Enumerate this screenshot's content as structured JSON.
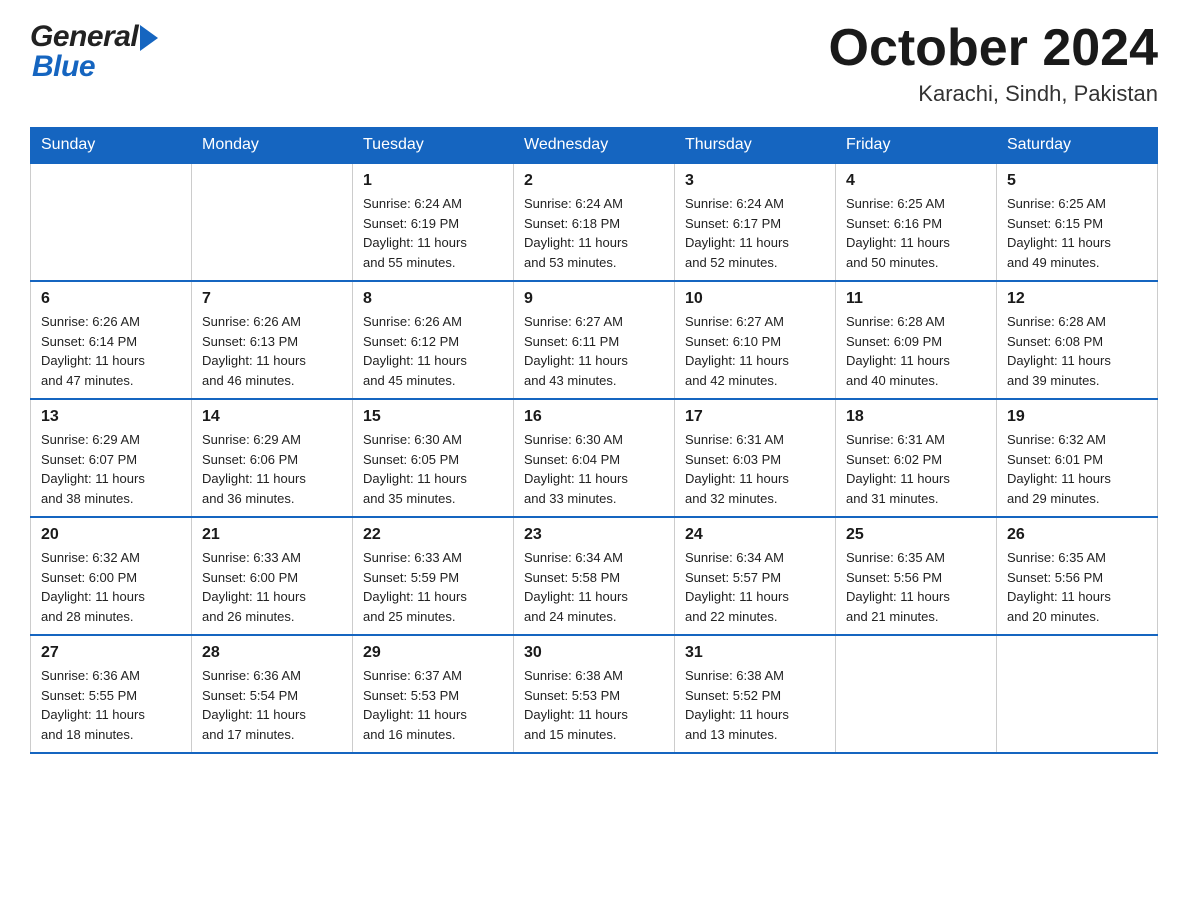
{
  "header": {
    "logo_general": "General",
    "logo_blue": "Blue",
    "title": "October 2024",
    "subtitle": "Karachi, Sindh, Pakistan"
  },
  "days": [
    "Sunday",
    "Monday",
    "Tuesday",
    "Wednesday",
    "Thursday",
    "Friday",
    "Saturday"
  ],
  "weeks": [
    [
      {
        "day": "",
        "info": ""
      },
      {
        "day": "",
        "info": ""
      },
      {
        "day": "1",
        "info": "Sunrise: 6:24 AM\nSunset: 6:19 PM\nDaylight: 11 hours\nand 55 minutes."
      },
      {
        "day": "2",
        "info": "Sunrise: 6:24 AM\nSunset: 6:18 PM\nDaylight: 11 hours\nand 53 minutes."
      },
      {
        "day": "3",
        "info": "Sunrise: 6:24 AM\nSunset: 6:17 PM\nDaylight: 11 hours\nand 52 minutes."
      },
      {
        "day": "4",
        "info": "Sunrise: 6:25 AM\nSunset: 6:16 PM\nDaylight: 11 hours\nand 50 minutes."
      },
      {
        "day": "5",
        "info": "Sunrise: 6:25 AM\nSunset: 6:15 PM\nDaylight: 11 hours\nand 49 minutes."
      }
    ],
    [
      {
        "day": "6",
        "info": "Sunrise: 6:26 AM\nSunset: 6:14 PM\nDaylight: 11 hours\nand 47 minutes."
      },
      {
        "day": "7",
        "info": "Sunrise: 6:26 AM\nSunset: 6:13 PM\nDaylight: 11 hours\nand 46 minutes."
      },
      {
        "day": "8",
        "info": "Sunrise: 6:26 AM\nSunset: 6:12 PM\nDaylight: 11 hours\nand 45 minutes."
      },
      {
        "day": "9",
        "info": "Sunrise: 6:27 AM\nSunset: 6:11 PM\nDaylight: 11 hours\nand 43 minutes."
      },
      {
        "day": "10",
        "info": "Sunrise: 6:27 AM\nSunset: 6:10 PM\nDaylight: 11 hours\nand 42 minutes."
      },
      {
        "day": "11",
        "info": "Sunrise: 6:28 AM\nSunset: 6:09 PM\nDaylight: 11 hours\nand 40 minutes."
      },
      {
        "day": "12",
        "info": "Sunrise: 6:28 AM\nSunset: 6:08 PM\nDaylight: 11 hours\nand 39 minutes."
      }
    ],
    [
      {
        "day": "13",
        "info": "Sunrise: 6:29 AM\nSunset: 6:07 PM\nDaylight: 11 hours\nand 38 minutes."
      },
      {
        "day": "14",
        "info": "Sunrise: 6:29 AM\nSunset: 6:06 PM\nDaylight: 11 hours\nand 36 minutes."
      },
      {
        "day": "15",
        "info": "Sunrise: 6:30 AM\nSunset: 6:05 PM\nDaylight: 11 hours\nand 35 minutes."
      },
      {
        "day": "16",
        "info": "Sunrise: 6:30 AM\nSunset: 6:04 PM\nDaylight: 11 hours\nand 33 minutes."
      },
      {
        "day": "17",
        "info": "Sunrise: 6:31 AM\nSunset: 6:03 PM\nDaylight: 11 hours\nand 32 minutes."
      },
      {
        "day": "18",
        "info": "Sunrise: 6:31 AM\nSunset: 6:02 PM\nDaylight: 11 hours\nand 31 minutes."
      },
      {
        "day": "19",
        "info": "Sunrise: 6:32 AM\nSunset: 6:01 PM\nDaylight: 11 hours\nand 29 minutes."
      }
    ],
    [
      {
        "day": "20",
        "info": "Sunrise: 6:32 AM\nSunset: 6:00 PM\nDaylight: 11 hours\nand 28 minutes."
      },
      {
        "day": "21",
        "info": "Sunrise: 6:33 AM\nSunset: 6:00 PM\nDaylight: 11 hours\nand 26 minutes."
      },
      {
        "day": "22",
        "info": "Sunrise: 6:33 AM\nSunset: 5:59 PM\nDaylight: 11 hours\nand 25 minutes."
      },
      {
        "day": "23",
        "info": "Sunrise: 6:34 AM\nSunset: 5:58 PM\nDaylight: 11 hours\nand 24 minutes."
      },
      {
        "day": "24",
        "info": "Sunrise: 6:34 AM\nSunset: 5:57 PM\nDaylight: 11 hours\nand 22 minutes."
      },
      {
        "day": "25",
        "info": "Sunrise: 6:35 AM\nSunset: 5:56 PM\nDaylight: 11 hours\nand 21 minutes."
      },
      {
        "day": "26",
        "info": "Sunrise: 6:35 AM\nSunset: 5:56 PM\nDaylight: 11 hours\nand 20 minutes."
      }
    ],
    [
      {
        "day": "27",
        "info": "Sunrise: 6:36 AM\nSunset: 5:55 PM\nDaylight: 11 hours\nand 18 minutes."
      },
      {
        "day": "28",
        "info": "Sunrise: 6:36 AM\nSunset: 5:54 PM\nDaylight: 11 hours\nand 17 minutes."
      },
      {
        "day": "29",
        "info": "Sunrise: 6:37 AM\nSunset: 5:53 PM\nDaylight: 11 hours\nand 16 minutes."
      },
      {
        "day": "30",
        "info": "Sunrise: 6:38 AM\nSunset: 5:53 PM\nDaylight: 11 hours\nand 15 minutes."
      },
      {
        "day": "31",
        "info": "Sunrise: 6:38 AM\nSunset: 5:52 PM\nDaylight: 11 hours\nand 13 minutes."
      },
      {
        "day": "",
        "info": ""
      },
      {
        "day": "",
        "info": ""
      }
    ]
  ]
}
